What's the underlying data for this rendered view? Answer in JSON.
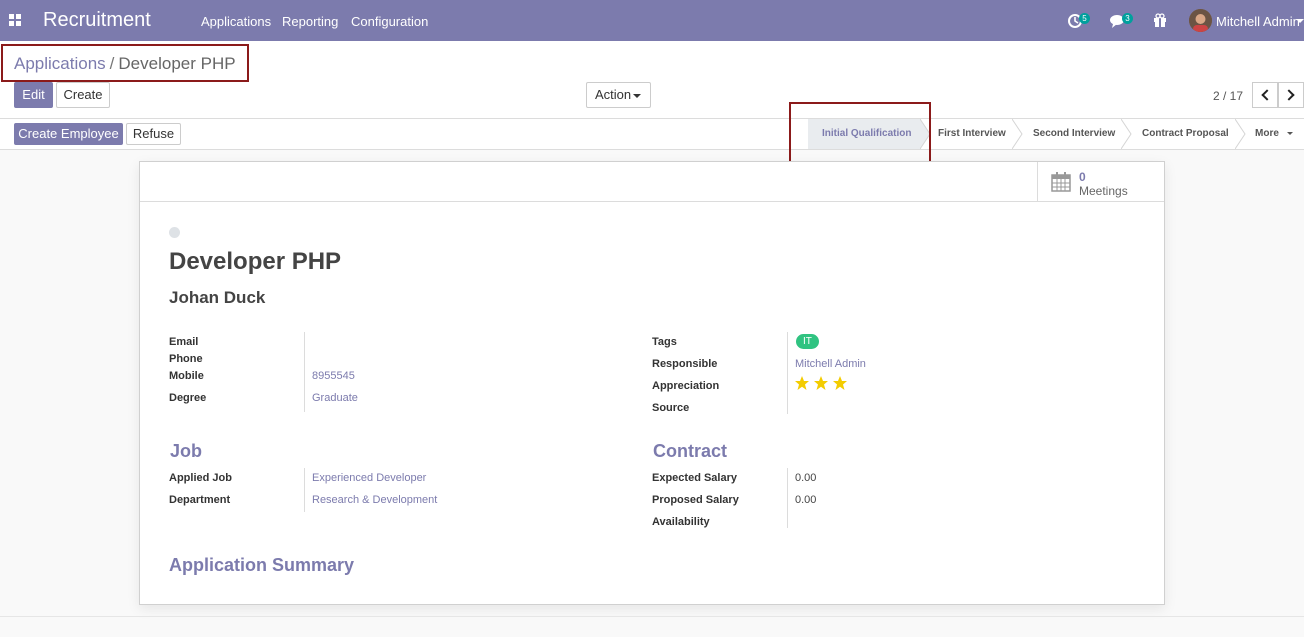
{
  "navbar": {
    "app_title": "Recruitment",
    "menus": [
      "Applications",
      "Reporting",
      "Configuration"
    ],
    "activity_badge": "5",
    "message_badge": "3",
    "user_name": "Mitchell Admin"
  },
  "breadcrumb": {
    "parent": "Applications",
    "separator": "/",
    "current": "Developer PHP"
  },
  "toolbar": {
    "edit_label": "Edit",
    "create_label": "Create",
    "action_label": "Action",
    "pager": "2 / 17"
  },
  "header": {
    "create_employee_label": "Create Employee",
    "refuse_label": "Refuse",
    "stages": [
      "Initial Qualification",
      "First Interview",
      "Second Interview",
      "Contract Proposal"
    ],
    "active_stage": "Initial Qualification",
    "more_label": "More"
  },
  "smart_button": {
    "count": "0",
    "label": "Meetings"
  },
  "applicant": {
    "title": "Developer PHP",
    "name": "Johan Duck"
  },
  "left_fields": [
    {
      "label": "Email",
      "value": ""
    },
    {
      "label": "Phone",
      "value": ""
    },
    {
      "label": "Mobile",
      "value": "8955545"
    },
    {
      "label": "Degree",
      "value": "Graduate"
    }
  ],
  "right_fields": {
    "tags_label": "Tags",
    "tag": "IT",
    "responsible_label": "Responsible",
    "responsible": "Mitchell Admin",
    "appreciation_label": "Appreciation",
    "appreciation_stars": 3,
    "source_label": "Source",
    "source": ""
  },
  "job": {
    "title": "Job",
    "applied_job_label": "Applied Job",
    "applied_job": "Experienced Developer",
    "department_label": "Department",
    "department": "Research & Development"
  },
  "contract": {
    "title": "Contract",
    "expected_label": "Expected Salary",
    "expected": "0.00",
    "proposed_label": "Proposed Salary",
    "proposed": "0.00",
    "availability_label": "Availability",
    "availability": ""
  },
  "summary": {
    "title": "Application Summary"
  },
  "colors": {
    "brand": "#7c7bad",
    "tag": "#30c381",
    "star": "#f3cc00",
    "highlight": "#8b1a1a"
  }
}
